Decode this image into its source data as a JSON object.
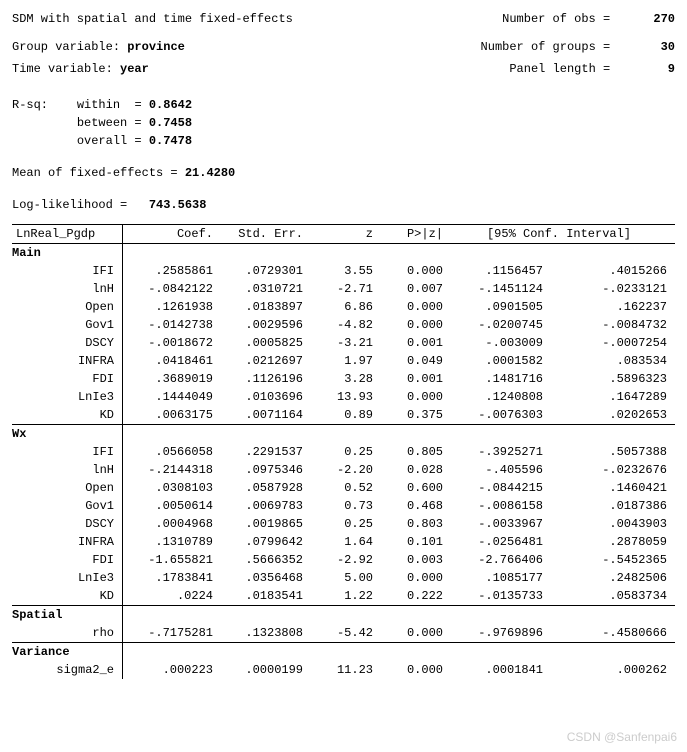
{
  "header": {
    "title": "SDM with spatial and time fixed-effects",
    "nobs_label": "Number of obs =",
    "nobs": "270",
    "group_label": "Group variable:",
    "group_var": "province",
    "ngroups_label": "Number of groups =",
    "ngroups": "30",
    "time_label": "Time variable:",
    "time_var": "year",
    "panellen_label": "Panel length =",
    "panellen": "9"
  },
  "rsq": {
    "label": "R-sq:",
    "within_label": "within  =",
    "within": "0.8642",
    "between_label": "between =",
    "between": "0.7458",
    "overall_label": "overall =",
    "overall": "0.7478"
  },
  "fe": {
    "label": "Mean of fixed-effects =",
    "val": "21.4280"
  },
  "ll": {
    "label": "Log-likelihood =",
    "val": "743.5638"
  },
  "th": {
    "depvar": "LnReal_Pgdp",
    "coef": "Coef.",
    "se": "Std. Err.",
    "z": "z",
    "p": "P>|z|",
    "ci": "[95% Conf. Interval]"
  },
  "sections": {
    "main": "Main",
    "wx": "Wx",
    "spatial": "Spatial",
    "variance": "Variance"
  },
  "main": [
    {
      "v": "IFI",
      "c": ".2585861",
      "s": ".0729301",
      "z": "3.55",
      "p": "0.000",
      "l": ".1156457",
      "u": ".4015266"
    },
    {
      "v": "lnH",
      "c": "-.0842122",
      "s": ".0310721",
      "z": "-2.71",
      "p": "0.007",
      "l": "-.1451124",
      "u": "-.0233121"
    },
    {
      "v": "Open",
      "c": ".1261938",
      "s": ".0183897",
      "z": "6.86",
      "p": "0.000",
      "l": ".0901505",
      "u": ".162237"
    },
    {
      "v": "Gov1",
      "c": "-.0142738",
      "s": ".0029596",
      "z": "-4.82",
      "p": "0.000",
      "l": "-.0200745",
      "u": "-.0084732"
    },
    {
      "v": "DSCY",
      "c": "-.0018672",
      "s": ".0005825",
      "z": "-3.21",
      "p": "0.001",
      "l": "-.003009",
      "u": "-.0007254"
    },
    {
      "v": "INFRA",
      "c": ".0418461",
      "s": ".0212697",
      "z": "1.97",
      "p": "0.049",
      "l": ".0001582",
      "u": ".083534"
    },
    {
      "v": "FDI",
      "c": ".3689019",
      "s": ".1126196",
      "z": "3.28",
      "p": "0.001",
      "l": ".1481716",
      "u": ".5896323"
    },
    {
      "v": "LnIe3",
      "c": ".1444049",
      "s": ".0103696",
      "z": "13.93",
      "p": "0.000",
      "l": ".1240808",
      "u": ".1647289"
    },
    {
      "v": "KD",
      "c": ".0063175",
      "s": ".0071164",
      "z": "0.89",
      "p": "0.375",
      "l": "-.0076303",
      "u": ".0202653"
    }
  ],
  "wx": [
    {
      "v": "IFI",
      "c": ".0566058",
      "s": ".2291537",
      "z": "0.25",
      "p": "0.805",
      "l": "-.3925271",
      "u": ".5057388"
    },
    {
      "v": "lnH",
      "c": "-.2144318",
      "s": ".0975346",
      "z": "-2.20",
      "p": "0.028",
      "l": "-.405596",
      "u": "-.0232676"
    },
    {
      "v": "Open",
      "c": ".0308103",
      "s": ".0587928",
      "z": "0.52",
      "p": "0.600",
      "l": "-.0844215",
      "u": ".1460421"
    },
    {
      "v": "Gov1",
      "c": ".0050614",
      "s": ".0069783",
      "z": "0.73",
      "p": "0.468",
      "l": "-.0086158",
      "u": ".0187386"
    },
    {
      "v": "DSCY",
      "c": ".0004968",
      "s": ".0019865",
      "z": "0.25",
      "p": "0.803",
      "l": "-.0033967",
      "u": ".0043903"
    },
    {
      "v": "INFRA",
      "c": ".1310789",
      "s": ".0799642",
      "z": "1.64",
      "p": "0.101",
      "l": "-.0256481",
      "u": ".2878059"
    },
    {
      "v": "FDI",
      "c": "-1.655821",
      "s": ".5666352",
      "z": "-2.92",
      "p": "0.003",
      "l": "-2.766406",
      "u": "-.5452365"
    },
    {
      "v": "LnIe3",
      "c": ".1783841",
      "s": ".0356468",
      "z": "5.00",
      "p": "0.000",
      "l": ".1085177",
      "u": ".2482506"
    },
    {
      "v": "KD",
      "c": ".0224",
      "s": ".0183541",
      "z": "1.22",
      "p": "0.222",
      "l": "-.0135733",
      "u": ".0583734"
    }
  ],
  "spatial": [
    {
      "v": "rho",
      "c": "-.7175281",
      "s": ".1323808",
      "z": "-5.42",
      "p": "0.000",
      "l": "-.9769896",
      "u": "-.4580666"
    }
  ],
  "variance": [
    {
      "v": "sigma2_e",
      "c": ".000223",
      "s": ".0000199",
      "z": "11.23",
      "p": "0.000",
      "l": ".0001841",
      "u": ".000262"
    }
  ],
  "watermark": "CSDN @Sanfenpai6"
}
